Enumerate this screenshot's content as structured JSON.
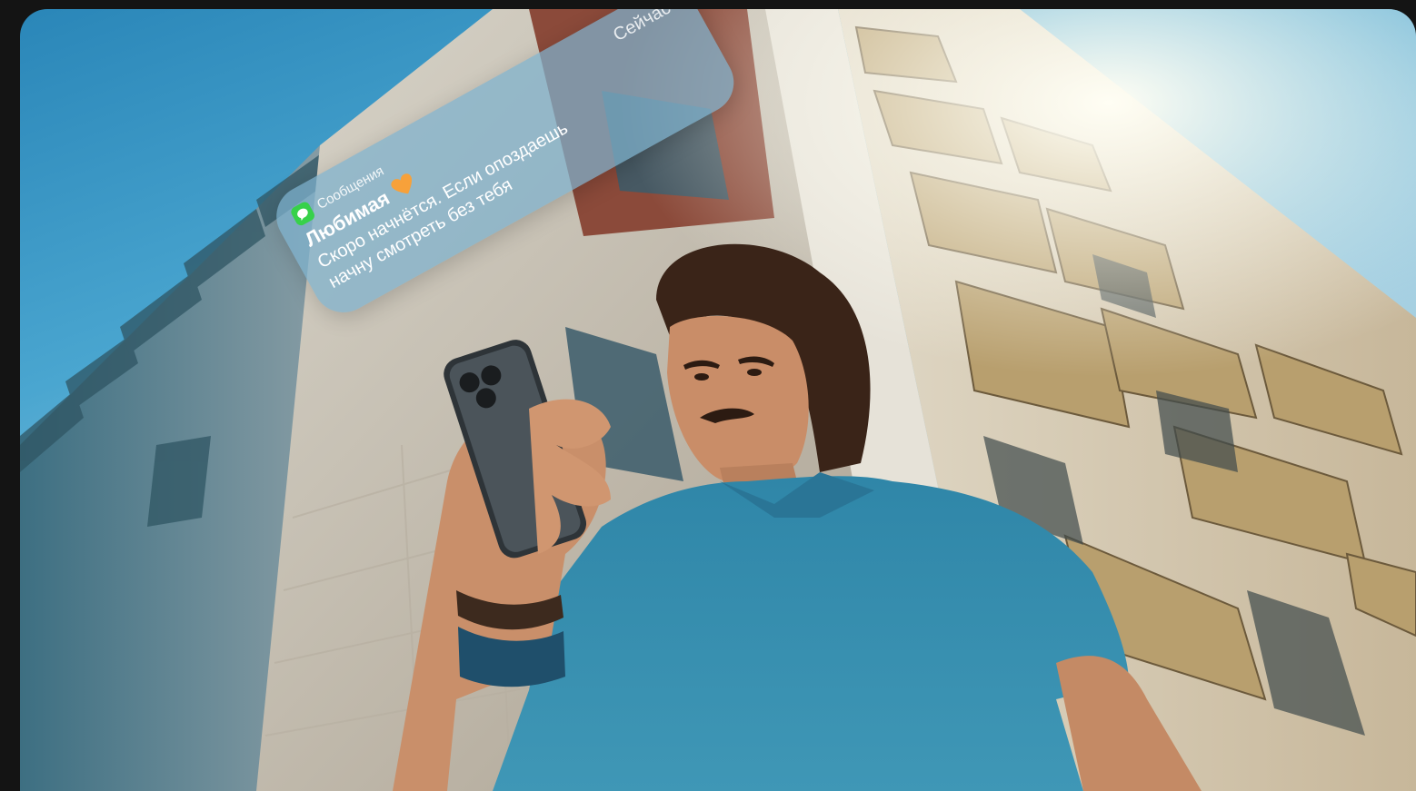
{
  "notification": {
    "app_icon": "chat-bubble-icon",
    "app_name": "Сообщения",
    "time": "Сейчас",
    "sender": "Любимая",
    "sender_emoji": "orange-heart-icon",
    "body_line1": "Скоро начнётся. Если опоздаешь",
    "body_line2": "начну смотреть без тебя"
  },
  "colors": {
    "background": "#141414",
    "sky": "#2a86b8",
    "notification": "#7eb2cd",
    "messages_green": "#37d14a",
    "heart": "#f7a13a",
    "shirt": "#3a8fb0"
  }
}
